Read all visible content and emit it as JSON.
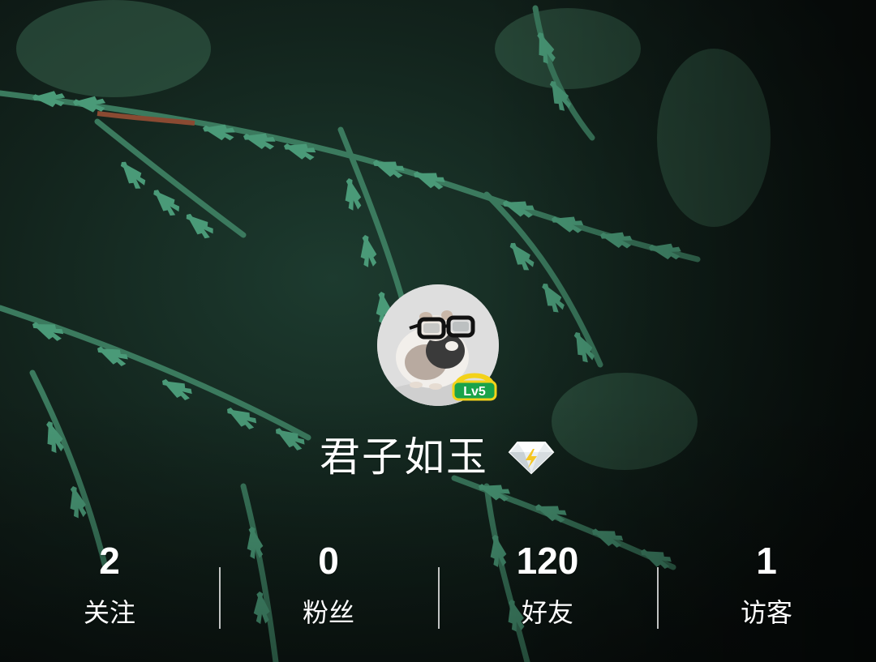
{
  "profile": {
    "nickname": "君子如玉",
    "level_badge": "Lv5",
    "vip_icon": "diamond-icon",
    "avatar_icon": "guinea-pig-with-glasses-avatar",
    "background": "cedar-branches-photo"
  },
  "stats": [
    {
      "count": "2",
      "label": "关注"
    },
    {
      "count": "0",
      "label": "粉丝"
    },
    {
      "count": "120",
      "label": "好友"
    },
    {
      "count": "1",
      "label": "访客"
    }
  ],
  "colors": {
    "badge_green": "#1aa34a",
    "badge_yellow": "#f3d21a",
    "foliage": "#3f8a6c",
    "background_dark": "#0d1411",
    "text": "#ffffff"
  }
}
